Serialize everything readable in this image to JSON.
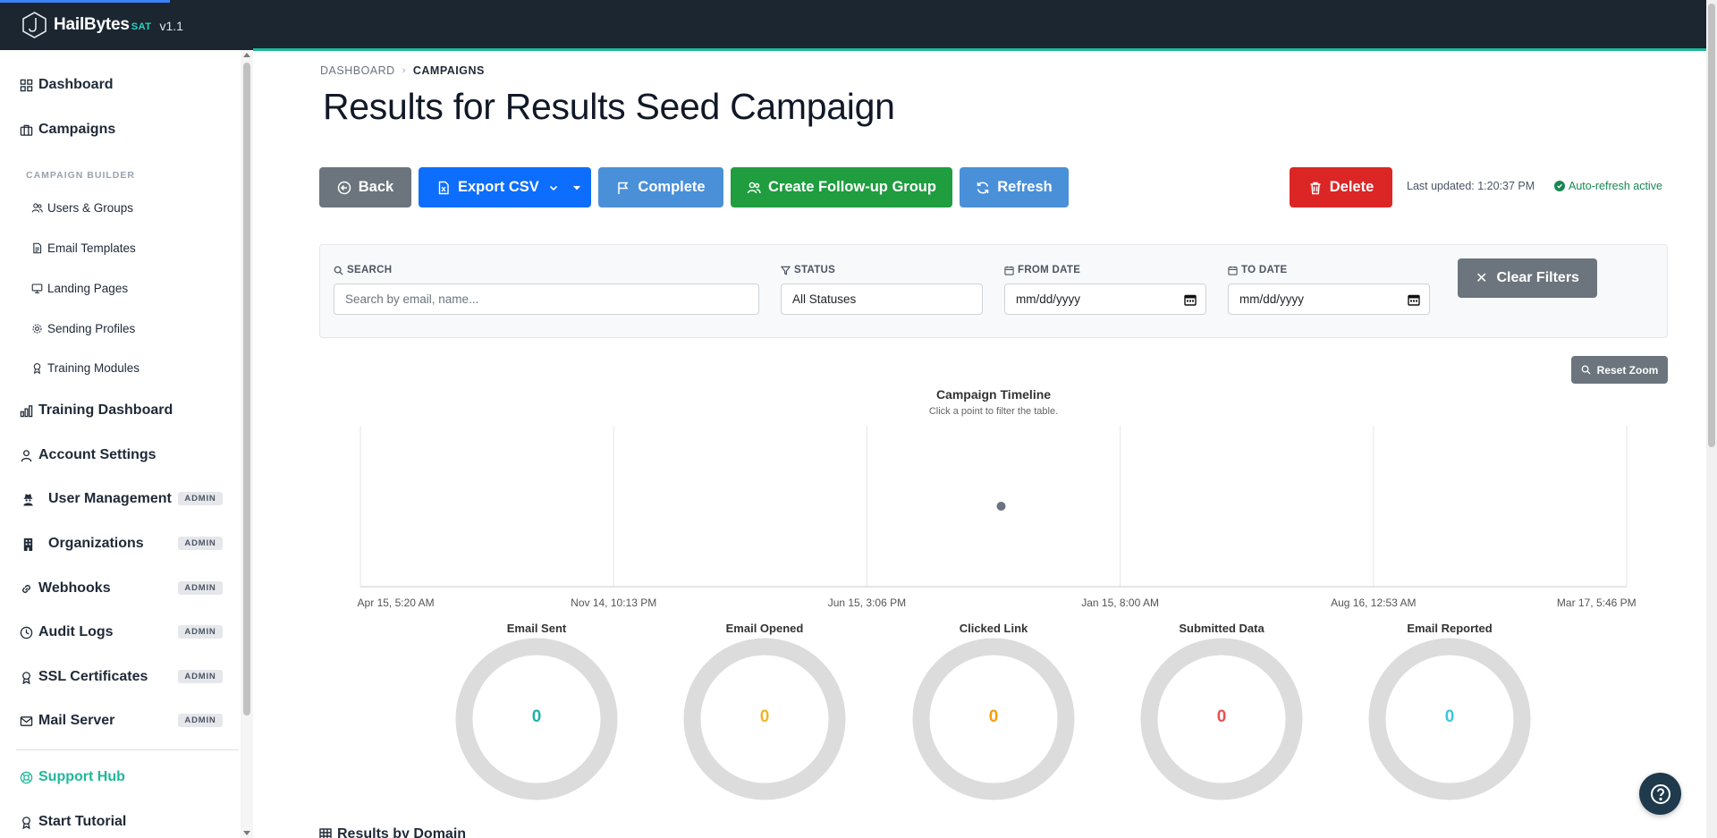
{
  "app": {
    "brand": "HailBytes",
    "brand_suffix": "SAT",
    "version": "v1.1"
  },
  "sidebar": {
    "items": [
      {
        "label": "Dashboard",
        "icon": "grid-icon"
      },
      {
        "label": "Campaigns",
        "icon": "briefcase-icon"
      }
    ],
    "section_label": "CAMPAIGN BUILDER",
    "sub_items": [
      {
        "label": "Users & Groups",
        "icon": "users-icon"
      },
      {
        "label": "Email Templates",
        "icon": "file-icon"
      },
      {
        "label": "Landing Pages",
        "icon": "monitor-icon"
      },
      {
        "label": "Sending Profiles",
        "icon": "gear-icon"
      },
      {
        "label": "Training Modules",
        "icon": "award-icon"
      }
    ],
    "lower_items": [
      {
        "label": "Training Dashboard",
        "icon": "bar-chart-icon"
      },
      {
        "label": "Account Settings",
        "icon": "person-icon"
      },
      {
        "label": "User Management",
        "icon": "user-secret-icon",
        "badge": "ADMIN"
      },
      {
        "label": "Organizations",
        "icon": "building-icon",
        "badge": "ADMIN"
      },
      {
        "label": "Webhooks",
        "icon": "link-icon",
        "badge": "ADMIN"
      },
      {
        "label": "Audit Logs",
        "icon": "clock-icon",
        "badge": "ADMIN"
      },
      {
        "label": "SSL Certificates",
        "icon": "award-icon",
        "badge": "ADMIN"
      },
      {
        "label": "Mail Server",
        "icon": "envelope-icon",
        "badge": "ADMIN"
      }
    ],
    "support_hub": "Support Hub",
    "start_tutorial": "Start Tutorial"
  },
  "breadcrumb": {
    "parent": "DASHBOARD",
    "current": "CAMPAIGNS"
  },
  "page_title": "Results for Results Seed Campaign",
  "toolbar": {
    "back": "Back",
    "export": "Export CSV",
    "complete": "Complete",
    "followup": "Create Follow-up Group",
    "refresh": "Refresh",
    "delete": "Delete",
    "last_updated": "Last updated: 1:20:37 PM",
    "auto_refresh": "Auto-refresh active"
  },
  "filters": {
    "search_label": "SEARCH",
    "search_placeholder": "Search by email, name...",
    "status_label": "STATUS",
    "status_value": "All Statuses",
    "from_label": "FROM DATE",
    "from_value": "mm/dd/yyyy",
    "to_label": "TO DATE",
    "to_value": "mm/dd/yyyy",
    "clear": "Clear Filters"
  },
  "reset_zoom": "Reset Zoom",
  "chart_data": {
    "type": "scatter",
    "title": "Campaign Timeline",
    "subtitle": "Click a point to filter the table.",
    "x_ticks": [
      "Apr 15, 5:20 AM",
      "Nov 14, 10:13 PM",
      "Jun 15, 3:06 PM",
      "Jan 15, 8:00 AM",
      "Aug 16, 12:53 AM",
      "Mar 17, 5:46 PM"
    ],
    "points": [
      {
        "x_fraction": 0.506,
        "y_fraction": 0.5
      }
    ],
    "point_color": "#6b7280",
    "grid": true
  },
  "stats": [
    {
      "label": "Email Sent",
      "value": "0",
      "color": "#20b2aa"
    },
    {
      "label": "Email Opened",
      "value": "0",
      "color": "#f0b429"
    },
    {
      "label": "Clicked Link",
      "value": "0",
      "color": "#f59e0b"
    },
    {
      "label": "Submitted Data",
      "value": "0",
      "color": "#e55353"
    },
    {
      "label": "Email Reported",
      "value": "0",
      "color": "#3bc6e0"
    }
  ],
  "results_by_domain": "Results by Domain"
}
